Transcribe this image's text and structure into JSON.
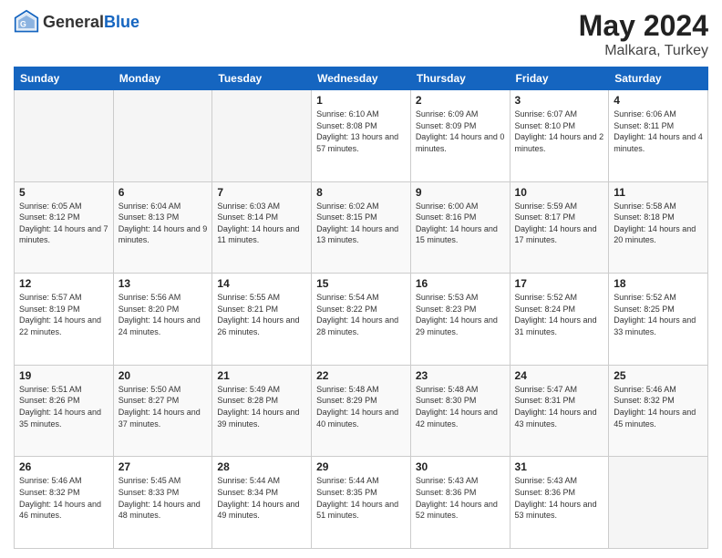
{
  "header": {
    "logo_general": "General",
    "logo_blue": "Blue",
    "title": "May 2024",
    "location": "Malkara, Turkey"
  },
  "days_of_week": [
    "Sunday",
    "Monday",
    "Tuesday",
    "Wednesday",
    "Thursday",
    "Friday",
    "Saturday"
  ],
  "weeks": [
    [
      {
        "day": "",
        "sunrise": "",
        "sunset": "",
        "daylight": ""
      },
      {
        "day": "",
        "sunrise": "",
        "sunset": "",
        "daylight": ""
      },
      {
        "day": "",
        "sunrise": "",
        "sunset": "",
        "daylight": ""
      },
      {
        "day": "1",
        "sunrise": "Sunrise: 6:10 AM",
        "sunset": "Sunset: 8:08 PM",
        "daylight": "Daylight: 13 hours and 57 minutes."
      },
      {
        "day": "2",
        "sunrise": "Sunrise: 6:09 AM",
        "sunset": "Sunset: 8:09 PM",
        "daylight": "Daylight: 14 hours and 0 minutes."
      },
      {
        "day": "3",
        "sunrise": "Sunrise: 6:07 AM",
        "sunset": "Sunset: 8:10 PM",
        "daylight": "Daylight: 14 hours and 2 minutes."
      },
      {
        "day": "4",
        "sunrise": "Sunrise: 6:06 AM",
        "sunset": "Sunset: 8:11 PM",
        "daylight": "Daylight: 14 hours and 4 minutes."
      }
    ],
    [
      {
        "day": "5",
        "sunrise": "Sunrise: 6:05 AM",
        "sunset": "Sunset: 8:12 PM",
        "daylight": "Daylight: 14 hours and 7 minutes."
      },
      {
        "day": "6",
        "sunrise": "Sunrise: 6:04 AM",
        "sunset": "Sunset: 8:13 PM",
        "daylight": "Daylight: 14 hours and 9 minutes."
      },
      {
        "day": "7",
        "sunrise": "Sunrise: 6:03 AM",
        "sunset": "Sunset: 8:14 PM",
        "daylight": "Daylight: 14 hours and 11 minutes."
      },
      {
        "day": "8",
        "sunrise": "Sunrise: 6:02 AM",
        "sunset": "Sunset: 8:15 PM",
        "daylight": "Daylight: 14 hours and 13 minutes."
      },
      {
        "day": "9",
        "sunrise": "Sunrise: 6:00 AM",
        "sunset": "Sunset: 8:16 PM",
        "daylight": "Daylight: 14 hours and 15 minutes."
      },
      {
        "day": "10",
        "sunrise": "Sunrise: 5:59 AM",
        "sunset": "Sunset: 8:17 PM",
        "daylight": "Daylight: 14 hours and 17 minutes."
      },
      {
        "day": "11",
        "sunrise": "Sunrise: 5:58 AM",
        "sunset": "Sunset: 8:18 PM",
        "daylight": "Daylight: 14 hours and 20 minutes."
      }
    ],
    [
      {
        "day": "12",
        "sunrise": "Sunrise: 5:57 AM",
        "sunset": "Sunset: 8:19 PM",
        "daylight": "Daylight: 14 hours and 22 minutes."
      },
      {
        "day": "13",
        "sunrise": "Sunrise: 5:56 AM",
        "sunset": "Sunset: 8:20 PM",
        "daylight": "Daylight: 14 hours and 24 minutes."
      },
      {
        "day": "14",
        "sunrise": "Sunrise: 5:55 AM",
        "sunset": "Sunset: 8:21 PM",
        "daylight": "Daylight: 14 hours and 26 minutes."
      },
      {
        "day": "15",
        "sunrise": "Sunrise: 5:54 AM",
        "sunset": "Sunset: 8:22 PM",
        "daylight": "Daylight: 14 hours and 28 minutes."
      },
      {
        "day": "16",
        "sunrise": "Sunrise: 5:53 AM",
        "sunset": "Sunset: 8:23 PM",
        "daylight": "Daylight: 14 hours and 29 minutes."
      },
      {
        "day": "17",
        "sunrise": "Sunrise: 5:52 AM",
        "sunset": "Sunset: 8:24 PM",
        "daylight": "Daylight: 14 hours and 31 minutes."
      },
      {
        "day": "18",
        "sunrise": "Sunrise: 5:52 AM",
        "sunset": "Sunset: 8:25 PM",
        "daylight": "Daylight: 14 hours and 33 minutes."
      }
    ],
    [
      {
        "day": "19",
        "sunrise": "Sunrise: 5:51 AM",
        "sunset": "Sunset: 8:26 PM",
        "daylight": "Daylight: 14 hours and 35 minutes."
      },
      {
        "day": "20",
        "sunrise": "Sunrise: 5:50 AM",
        "sunset": "Sunset: 8:27 PM",
        "daylight": "Daylight: 14 hours and 37 minutes."
      },
      {
        "day": "21",
        "sunrise": "Sunrise: 5:49 AM",
        "sunset": "Sunset: 8:28 PM",
        "daylight": "Daylight: 14 hours and 39 minutes."
      },
      {
        "day": "22",
        "sunrise": "Sunrise: 5:48 AM",
        "sunset": "Sunset: 8:29 PM",
        "daylight": "Daylight: 14 hours and 40 minutes."
      },
      {
        "day": "23",
        "sunrise": "Sunrise: 5:48 AM",
        "sunset": "Sunset: 8:30 PM",
        "daylight": "Daylight: 14 hours and 42 minutes."
      },
      {
        "day": "24",
        "sunrise": "Sunrise: 5:47 AM",
        "sunset": "Sunset: 8:31 PM",
        "daylight": "Daylight: 14 hours and 43 minutes."
      },
      {
        "day": "25",
        "sunrise": "Sunrise: 5:46 AM",
        "sunset": "Sunset: 8:32 PM",
        "daylight": "Daylight: 14 hours and 45 minutes."
      }
    ],
    [
      {
        "day": "26",
        "sunrise": "Sunrise: 5:46 AM",
        "sunset": "Sunset: 8:32 PM",
        "daylight": "Daylight: 14 hours and 46 minutes."
      },
      {
        "day": "27",
        "sunrise": "Sunrise: 5:45 AM",
        "sunset": "Sunset: 8:33 PM",
        "daylight": "Daylight: 14 hours and 48 minutes."
      },
      {
        "day": "28",
        "sunrise": "Sunrise: 5:44 AM",
        "sunset": "Sunset: 8:34 PM",
        "daylight": "Daylight: 14 hours and 49 minutes."
      },
      {
        "day": "29",
        "sunrise": "Sunrise: 5:44 AM",
        "sunset": "Sunset: 8:35 PM",
        "daylight": "Daylight: 14 hours and 51 minutes."
      },
      {
        "day": "30",
        "sunrise": "Sunrise: 5:43 AM",
        "sunset": "Sunset: 8:36 PM",
        "daylight": "Daylight: 14 hours and 52 minutes."
      },
      {
        "day": "31",
        "sunrise": "Sunrise: 5:43 AM",
        "sunset": "Sunset: 8:36 PM",
        "daylight": "Daylight: 14 hours and 53 minutes."
      },
      {
        "day": "",
        "sunrise": "",
        "sunset": "",
        "daylight": ""
      }
    ]
  ]
}
